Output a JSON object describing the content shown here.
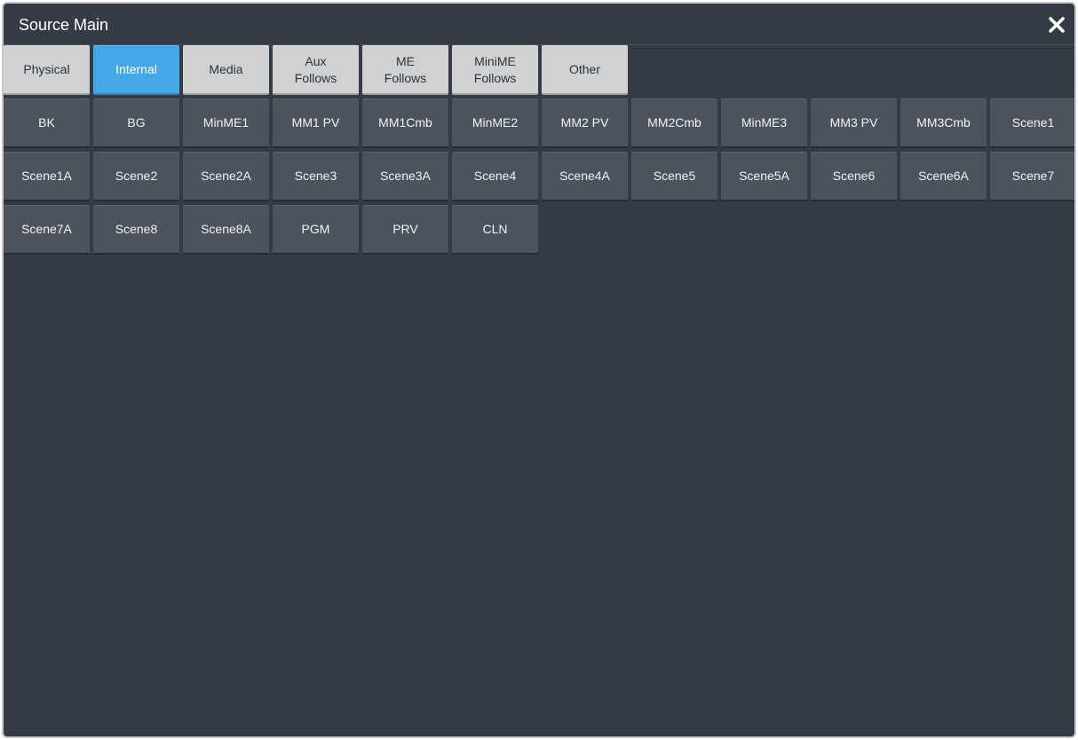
{
  "window": {
    "title": "Source Main",
    "close_label": "✕"
  },
  "tabs": [
    {
      "label": "Physical",
      "active": false
    },
    {
      "label": "Internal",
      "active": true
    },
    {
      "label": "Media",
      "active": false
    },
    {
      "label": "Aux\nFollows",
      "active": false
    },
    {
      "label": "ME\nFollows",
      "active": false
    },
    {
      "label": "MiniME\nFollows",
      "active": false
    },
    {
      "label": "Other",
      "active": false
    }
  ],
  "sources": [
    "BK",
    "BG",
    "MinME1",
    "MM1 PV",
    "MM1Cmb",
    "MinME2",
    "MM2 PV",
    "MM2Cmb",
    "MinME3",
    "MM3 PV",
    "MM3Cmb",
    "Scene1",
    "Scene1A",
    "Scene2",
    "Scene2A",
    "Scene3",
    "Scene3A",
    "Scene4",
    "Scene4A",
    "Scene5",
    "Scene5A",
    "Scene6",
    "Scene6A",
    "Scene7",
    "Scene7A",
    "Scene8",
    "Scene8A",
    "PGM",
    "PRV",
    "CLN"
  ],
  "colors": {
    "background": "#353b44",
    "tab": "#cfd1d3",
    "tab_active": "#44a8e6",
    "source_button": "#4c535e"
  }
}
